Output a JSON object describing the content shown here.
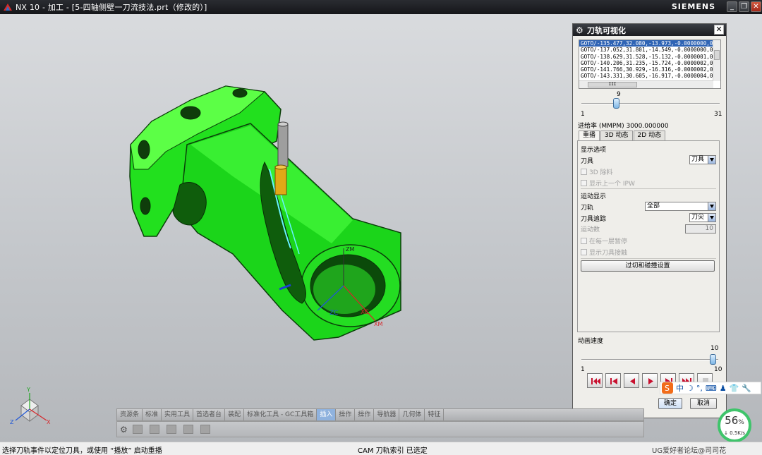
{
  "window": {
    "title": "NX 10 - 加工 - [5-四轴侧壁一刀流技法.prt（修改的）]",
    "brand": "SIEMENS",
    "controls": [
      "_",
      "❐",
      "✕"
    ]
  },
  "viewport": {
    "axis_labels": [
      "ZM",
      "ZC",
      "XC",
      "XM"
    ],
    "triad": [
      "Y",
      "Z",
      "X"
    ]
  },
  "dialog": {
    "title": "刀轨可视化",
    "goto_lines": [
      "GOTO/-135.477,32.080,-13.973,-0.0000000,0",
      "GOTO/-137.052,31.801,-14.549,-0.0000000,0",
      "GOTO/-138.629,31.528,-15.132,-0.0000001,0",
      "GOTO/-140.206,31.235,-15.724,-0.0000002,0",
      "GOTO/-141.766,30.929,-16.316,-0.0000002,0",
      "GOTO/-143.331,30.605,-16.917,-0.0000004,0"
    ],
    "hscroll_label": "III",
    "slider": {
      "value": "9",
      "min": "1",
      "max": "31",
      "fraction": 0.267
    },
    "feed_label": "进给率 (MMPM) 3000.000000",
    "tabs": [
      "重播",
      "3D 动态",
      "2D 动态"
    ],
    "display_options": "显示选项",
    "tool_label": "刀具",
    "tool_value": "刀具",
    "check_3d": "3D 除料",
    "check_prev_ipw": "显示上一个 IPW",
    "motion_display": "运动显示",
    "toolpath_label": "刀轨",
    "toolpath_value": "全部",
    "tool_trace_label": "刀具追踪",
    "tool_trace_value": "刀尖",
    "motion_count_label": "运动数",
    "motion_count_value": "10",
    "check_pause": "在每一层暂停",
    "check_contact": "显示刀具接触",
    "gouge_button": "过切和碰撞设置",
    "anim_speed_label": "动画速度",
    "anim_speed": {
      "value": "10",
      "min": "1",
      "max": "10",
      "fraction": 1.0
    },
    "ok": "确定",
    "cancel": "取消"
  },
  "toolbar_tabs": [
    "资源条",
    "标准",
    "实用工具",
    "首选者台",
    "装配",
    "标准化工具 - GC工具箱",
    "插入",
    "操作",
    "操作",
    "导航器",
    "几何体",
    "特征"
  ],
  "status": {
    "left": "选择刀轨事件以定位刀具，或使用 “播放” 启动重播",
    "center": "CAM 刀轨索引 已选定",
    "watermark": "UG爱好者论坛@司司花"
  },
  "ime": {
    "lang": "中"
  },
  "network": {
    "percent": "56",
    "percent_suffix": "%",
    "rate": "0.5K/s"
  }
}
